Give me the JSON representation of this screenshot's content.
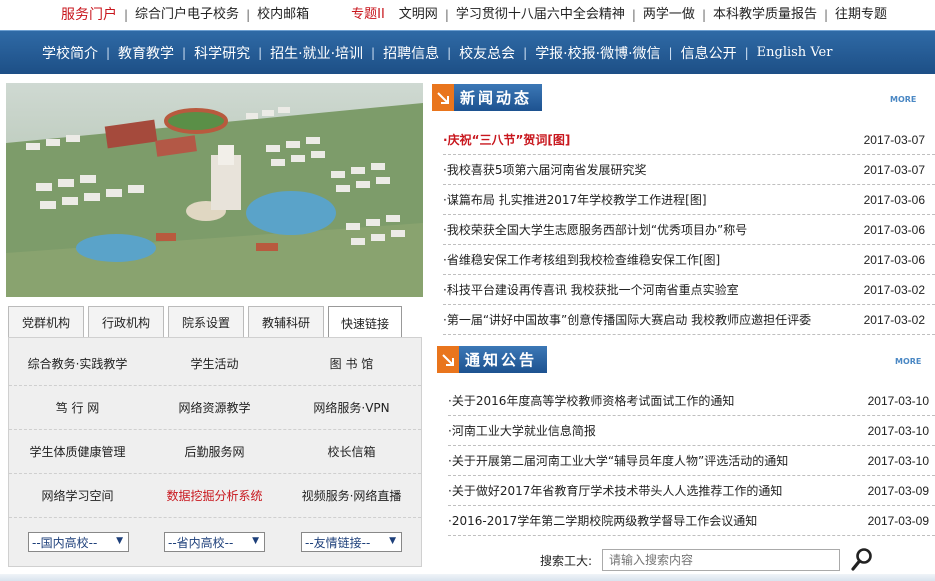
{
  "topbar": {
    "items": [
      "服务门户",
      "综合门户电子校务",
      "校内邮箱"
    ],
    "special": [
      "专题II",
      "文明网",
      "学习贯彻十八届六中全会精神",
      "两学一做",
      "本科教学质量报告",
      "往期专题"
    ]
  },
  "mainnav": {
    "items": [
      "学校简介",
      "教育教学",
      "科学研究",
      "招生·就业·培训",
      "招聘信息",
      "校友总会",
      "学报·校报·微博·微信",
      "信息公开",
      "English Ver"
    ]
  },
  "tabs": [
    "党群机构",
    "行政机构",
    "院系设置",
    "教辅科研",
    "快速链接"
  ],
  "quicklinks": [
    [
      "综合教务·实践教学",
      "学生活动",
      "图 书 馆"
    ],
    [
      "笃 行 网",
      "网络资源教学",
      "网络服务·VPN"
    ],
    [
      "学生体质健康管理",
      "后勤服务网",
      "校长信箱"
    ],
    [
      "网络学习空间",
      "数据挖掘分析系统",
      "视频服务·网络直播"
    ]
  ],
  "selects": [
    "--国内高校--",
    "--省内高校--",
    "--友情链接--"
  ],
  "news": {
    "heading": "新闻动态",
    "more": "MORE",
    "items": [
      {
        "title": "庆祝“三八节”贺词[图]",
        "date": "2017-03-07"
      },
      {
        "title": "我校喜获5项第六届河南省发展研究奖",
        "date": "2017-03-07"
      },
      {
        "title": "谋篇布局 扎实推进2017年学校教学工作进程[图]",
        "date": "2017-03-06"
      },
      {
        "title": "我校荣获全国大学生志愿服务西部计划“优秀项目办”称号",
        "date": "2017-03-06"
      },
      {
        "title": "省维稳安保工作考核组到我校检查维稳安保工作[图]",
        "date": "2017-03-06"
      },
      {
        "title": "科技平台建设再传喜讯 我校获批一个河南省重点实验室",
        "date": "2017-03-02"
      },
      {
        "title": "第一届“讲好中国故事”创意传播国际大赛启动 我校教师应邀担任评委",
        "date": "2017-03-02"
      }
    ]
  },
  "notices": {
    "heading": "通知公告",
    "more": "MORE",
    "items": [
      {
        "title": "关于2016年度高等学校教师资格考试面试工作的通知",
        "date": "2017-03-10"
      },
      {
        "title": "河南工业大学就业信息简报",
        "date": "2017-03-10"
      },
      {
        "title": "关于开展第二届河南工业大学“辅导员年度人物”评选活动的通知",
        "date": "2017-03-10"
      },
      {
        "title": "关于做好2017年省教育厅学术技术带头人人选推荐工作的通知",
        "date": "2017-03-09"
      },
      {
        "title": "2016-2017学年第二学期校院两级教学督导工作会议通知",
        "date": "2017-03-09"
      }
    ]
  },
  "search": {
    "label": "搜索工大:",
    "placeholder": "请输入搜索内容"
  },
  "icons": {
    "arrow": "arrow-right-icon",
    "search": "magnifier-icon"
  },
  "colors": {
    "accent_red": "#c8161d",
    "nav_blue": "#1d4f86",
    "icon_orange": "#e9751d"
  }
}
